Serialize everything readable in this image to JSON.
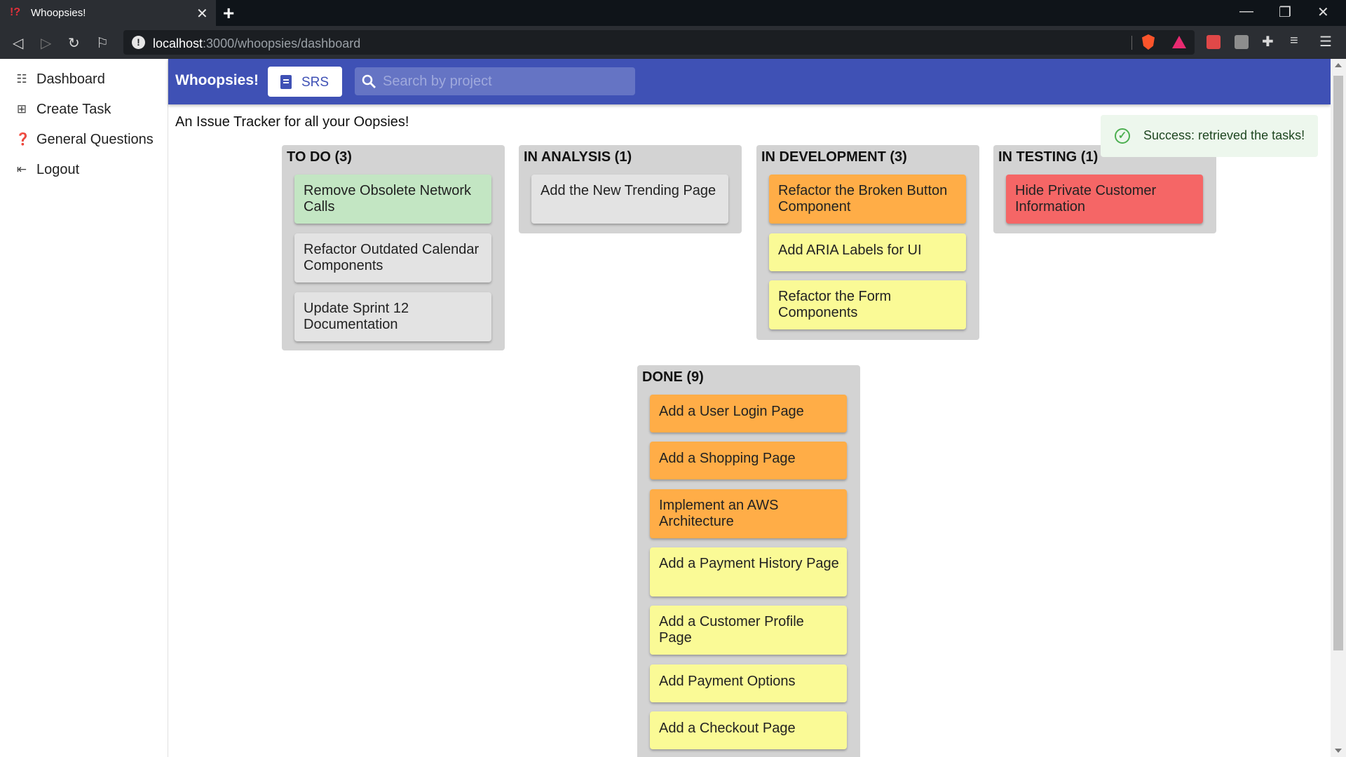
{
  "browser": {
    "tab_title": "Whoopsies!",
    "tab_favicon": "!?",
    "new_tab_label": "+",
    "url_host": "localhost",
    "url_path": ":3000/whoopsies/dashboard"
  },
  "sidebar": {
    "items": [
      {
        "label": "Dashboard",
        "icon": "list-icon"
      },
      {
        "label": "Create Task",
        "icon": "add-box-icon"
      },
      {
        "label": "General Questions",
        "icon": "help-circle-icon"
      },
      {
        "label": "Logout",
        "icon": "logout-icon"
      }
    ]
  },
  "appbar": {
    "title": "Whoopsies!",
    "srs_label": "SRS",
    "search_placeholder": "Search by project"
  },
  "tagline": "An Issue Tracker for all your Oopsies!",
  "toast": {
    "message": "Success: retrieved the tasks!"
  },
  "colors": {
    "appbar": "#3f51b5",
    "card_green": "#c3e6c3",
    "card_grey": "#e3e3e3",
    "card_orange": "#ffad47",
    "card_yellow": "#fafa96",
    "card_red": "#f56666"
  },
  "board": {
    "columns": [
      {
        "title": "TO DO (3)",
        "cards": [
          {
            "text": "Remove Obsolete Network Calls",
            "color": "green"
          },
          {
            "text": "Refactor Outdated Calendar Components",
            "color": "grey"
          },
          {
            "text": "Update Sprint 12 Documentation",
            "color": "grey"
          }
        ]
      },
      {
        "title": "IN ANALYSIS (1)",
        "cards": [
          {
            "text": "Add the New Trending Page",
            "color": "grey"
          }
        ]
      },
      {
        "title": "IN DEVELOPMENT (3)",
        "cards": [
          {
            "text": "Refactor the Broken Button Component",
            "color": "orange"
          },
          {
            "text": "Add ARIA Labels for UI",
            "color": "yellow"
          },
          {
            "text": "Refactor the Form Components",
            "color": "yellow"
          }
        ]
      },
      {
        "title": "IN TESTING (1)",
        "cards": [
          {
            "text": "Hide Private Customer Information",
            "color": "red"
          }
        ]
      },
      {
        "title": "DONE (9)",
        "cards": [
          {
            "text": "Add a User Login Page",
            "color": "orange"
          },
          {
            "text": "Add a Shopping Page",
            "color": "orange"
          },
          {
            "text": "Implement an AWS Architecture",
            "color": "orange"
          },
          {
            "text": "Add a Payment History Page",
            "color": "yellow"
          },
          {
            "text": "Add a Customer Profile Page",
            "color": "yellow"
          },
          {
            "text": "Add Payment Options",
            "color": "yellow"
          },
          {
            "text": "Add a Checkout Page",
            "color": "yellow"
          }
        ]
      }
    ]
  }
}
